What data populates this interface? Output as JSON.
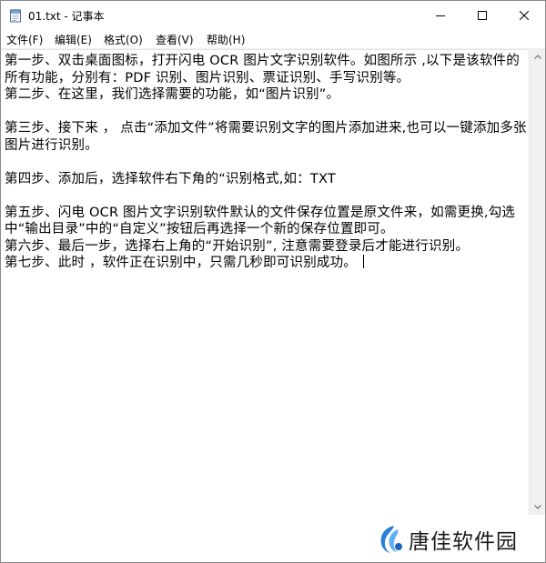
{
  "window": {
    "title": "01.txt - 记事本"
  },
  "menu": {
    "items": [
      {
        "label": "文件(F)"
      },
      {
        "label": "编辑(E)"
      },
      {
        "label": "格式(O)"
      },
      {
        "label": "查看(V)"
      },
      {
        "label": "帮助(H)"
      }
    ]
  },
  "editor": {
    "content": "第一步、双击桌面图标，打开闪电 OCR 图片文字识别软件。如图所示 ,以下是该软件的所有功能，分别有：PDF 识别、图片识别、票证识别、手写识别等。\n第二步、在这里，我们选择需要的功能，如“图片识别”。\n\n第三步、接下来 ， 点击“添加文件”将需要识别文字的图片添加进来,也可以一键添加多张图片进行识别。\n\n第四步、添加后，选择软件右下角的“识别格式,如：TXT\n\n第五步、闪电 OCR 图片文字识别软件默认的文件保存位置是原文件来，如需更换,勾选中“输出目录”中的“自定义”按钮后再选择一个新的保存位置即可。\n第六步、最后一步，选择右上角的“开始识别”, 注意需要登录后才能进行识别。\n第七步、此时 ，软件正在识别中，只需几秒即可识别成功。 "
  },
  "watermark": {
    "text": "唐佳软件园"
  },
  "icons": {
    "app": "notepad-icon",
    "minimize": "minimize-icon",
    "maximize": "maximize-icon",
    "close": "close-icon"
  },
  "colors": {
    "close_hover": "#e81123",
    "watermark_blue": "#1e88e5"
  }
}
